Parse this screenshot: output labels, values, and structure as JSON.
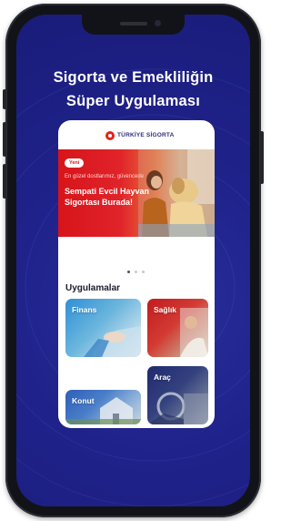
{
  "headline": {
    "line1": "Sigorta ve Emekliliğin",
    "line2": "Süper Uygulaması"
  },
  "app": {
    "brand_name": "TÜRKİYE SİGORTA",
    "banner": {
      "badge": "Yeni",
      "tagline": "En güzel dostlarımız, güvencede",
      "promo_line1": "Sempati Evcil Hayvan",
      "promo_line2": "Sigortası Burada!"
    },
    "carousel": {
      "pages": 3,
      "active": 1
    },
    "section_title": "Uygulamalar",
    "tiles": [
      {
        "label": "Finans"
      },
      {
        "label": "Sağlık"
      },
      {
        "label": "Araç"
      },
      {
        "label": "Konut"
      }
    ]
  },
  "colors": {
    "background": "#1f228a",
    "brand_red": "#d7141a",
    "brand_navy": "#2b2f7f"
  }
}
